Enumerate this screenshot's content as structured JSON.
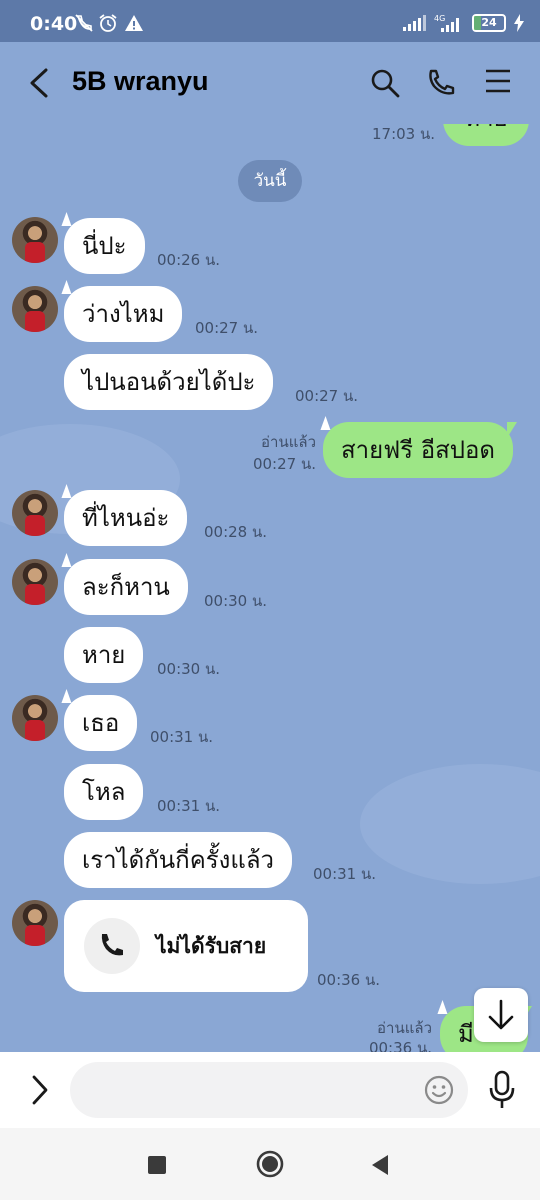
{
  "status_bar": {
    "time": "0:40",
    "battery": "24",
    "battery_level": 0.24,
    "icons": [
      "call-muted-icon",
      "alarm-icon",
      "warning-icon",
      "signal-icon",
      "4g-signal-icon",
      "battery-icon",
      "charging-icon"
    ]
  },
  "header": {
    "title": "5B wranyu",
    "icons": [
      "back-arrow-icon",
      "search-icon",
      "phone-icon",
      "menu-icon"
    ]
  },
  "chat": {
    "date_chip": "วันนี้",
    "top_partial": {
      "text": "หาย",
      "time": "17:03 น."
    },
    "messages": [
      {
        "text": "นี่ปะ",
        "time": "00:26 น."
      },
      {
        "text": "ว่างไหม",
        "time": "00:27 น."
      },
      {
        "text": "ไปนอนด้วยได้ปะ",
        "time": "00:27 น."
      },
      {
        "text": "สายฟรี อีสปอด",
        "time": "00:27 น.",
        "read": "อ่านแล้ว"
      },
      {
        "text": "ที่ไหนอ่ะ",
        "time": "00:28 น."
      },
      {
        "text": "ละก็หาน",
        "time": "00:30 น."
      },
      {
        "text": "หาย",
        "time": "00:30 น."
      },
      {
        "text": "เธอ",
        "time": "00:31 น."
      },
      {
        "text": "โหล",
        "time": "00:31 น."
      },
      {
        "text": "เราได้กันกี่ครั้งแล้ว",
        "time": "00:31 น."
      },
      {
        "text": "ไม่ได้รับสาย",
        "time": "00:36 น."
      },
      {
        "text": "มี",
        "time": "00:36 น.",
        "read": "อ่านแล้ว"
      }
    ],
    "accent_bubble_color": "#9de686"
  },
  "input_bar": {
    "placeholder": "",
    "icons": [
      "expand-chevron-icon",
      "emoji-icon",
      "microphone-icon"
    ]
  },
  "nav_bar": {
    "icons": [
      "recents-square-icon",
      "home-circle-icon",
      "back-triangle-icon"
    ]
  }
}
